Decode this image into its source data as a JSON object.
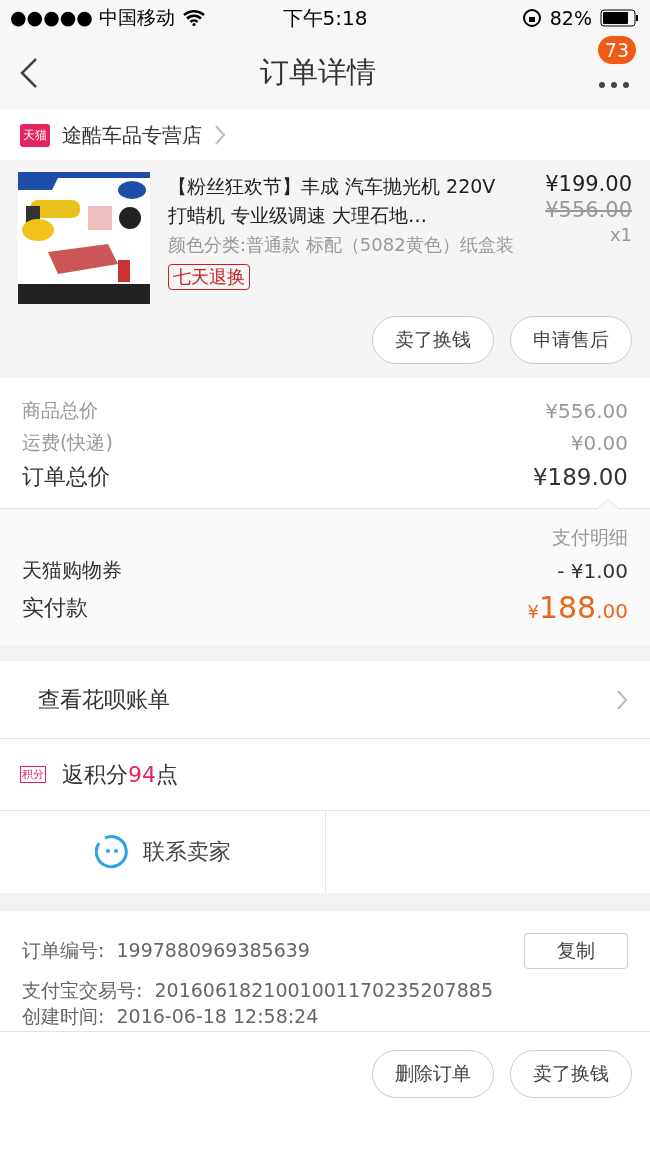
{
  "status_bar": {
    "carrier": "●●●●● 中国移动",
    "time": "下午5:18",
    "battery": "82%"
  },
  "nav": {
    "title": "订单详情",
    "badge": "73"
  },
  "store": {
    "badge": "天猫",
    "name": "途酷车品专营店"
  },
  "product": {
    "kind": "picture",
    "title": "【粉丝狂欢节】丰成 汽车抛光机 220V打蜡机 专业级调速 大理石地…",
    "spec": "颜色分类:普通款 标配（5082黄色）纸盒装",
    "tag": "七天退换",
    "price": "¥199.00",
    "original_price": "¥556.00",
    "quantity": "x1",
    "buttons": [
      "卖了换钱",
      "申请售后"
    ]
  },
  "totals": [
    {
      "label": "商品总价",
      "value": "¥556.00",
      "emphasis": false
    },
    {
      "label": "运费(快递)",
      "value": "¥0.00",
      "emphasis": false
    },
    {
      "label": "订单总价",
      "value": "¥189.00",
      "emphasis": true
    }
  ],
  "payment": {
    "heading": "支付明细",
    "coupon_label": "天猫购物券",
    "coupon_value": "- ¥1.00",
    "paid_label": "实付款",
    "paid_currency": "¥",
    "paid_integer": "188",
    "paid_decimal": ".00"
  },
  "huabei": {
    "label": "查看花呗账单"
  },
  "points": {
    "badge": "积分",
    "prefix": "返积分",
    "value": "94",
    "suffix": "点"
  },
  "contact": {
    "label": "联系卖家"
  },
  "order_info": {
    "number_label": "订单编号:",
    "number": "1997880969385639",
    "copy": "复制",
    "rows": [
      {
        "label": "支付宝交易号:",
        "value": "2016061821001001170235207885"
      },
      {
        "label": "创建时间:",
        "value": "2016-06-18 12:58:24"
      }
    ]
  },
  "bottom_buttons": [
    "删除订单",
    "卖了换钱"
  ]
}
